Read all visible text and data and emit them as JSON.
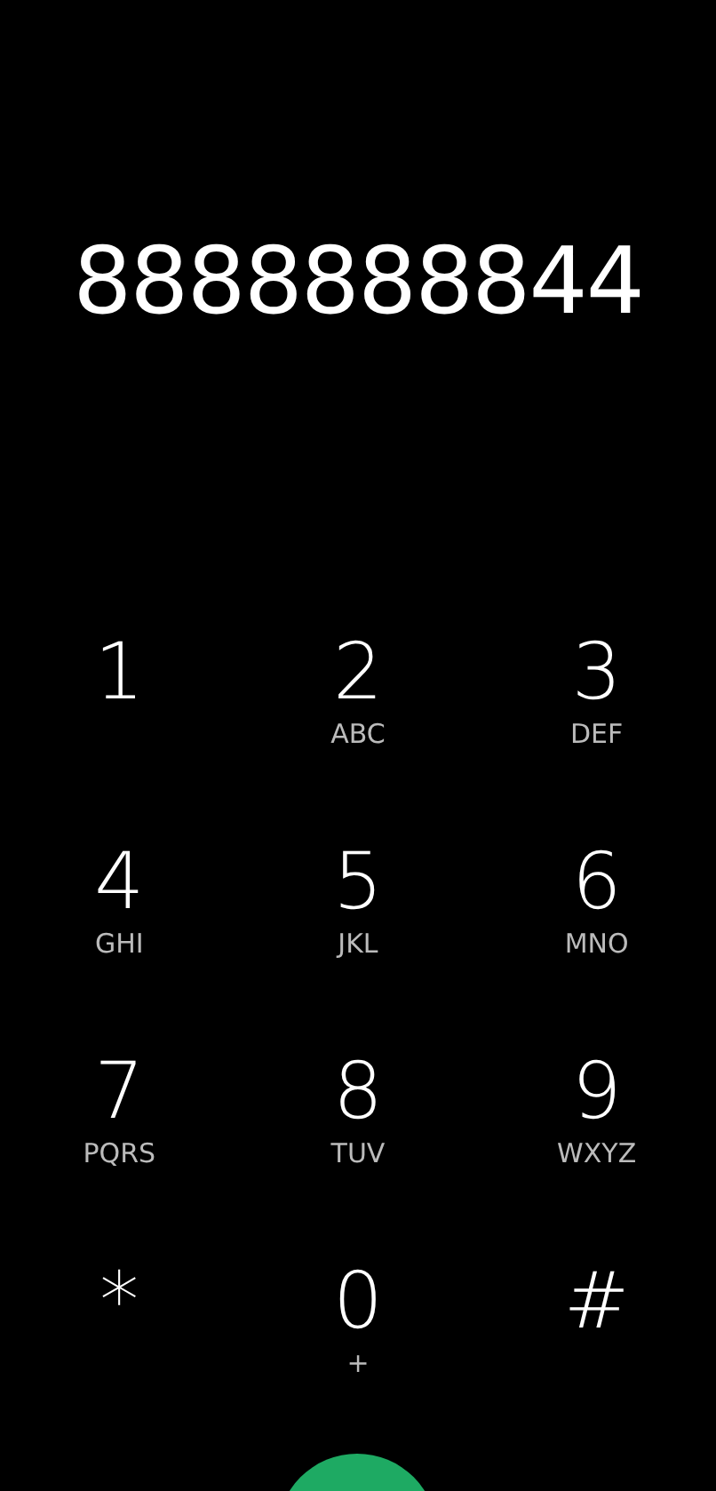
{
  "number": "8888888844",
  "keys": [
    {
      "digit": "1"
    },
    {
      "digit": "2",
      "letters": "ABC"
    },
    {
      "digit": "3",
      "letters": "DEF"
    },
    {
      "digit": "4",
      "letters": "GHI"
    },
    {
      "digit": "5",
      "letters": "JKL"
    },
    {
      "digit": "6",
      "letters": "MNO"
    },
    {
      "digit": "7",
      "letters": "PQRS"
    },
    {
      "digit": "8",
      "letters": "TUV"
    },
    {
      "digit": "9",
      "letters": "WXYZ"
    },
    {
      "digit": "*"
    },
    {
      "digit": "0",
      "letters": "+"
    },
    {
      "digit": "#"
    }
  ]
}
